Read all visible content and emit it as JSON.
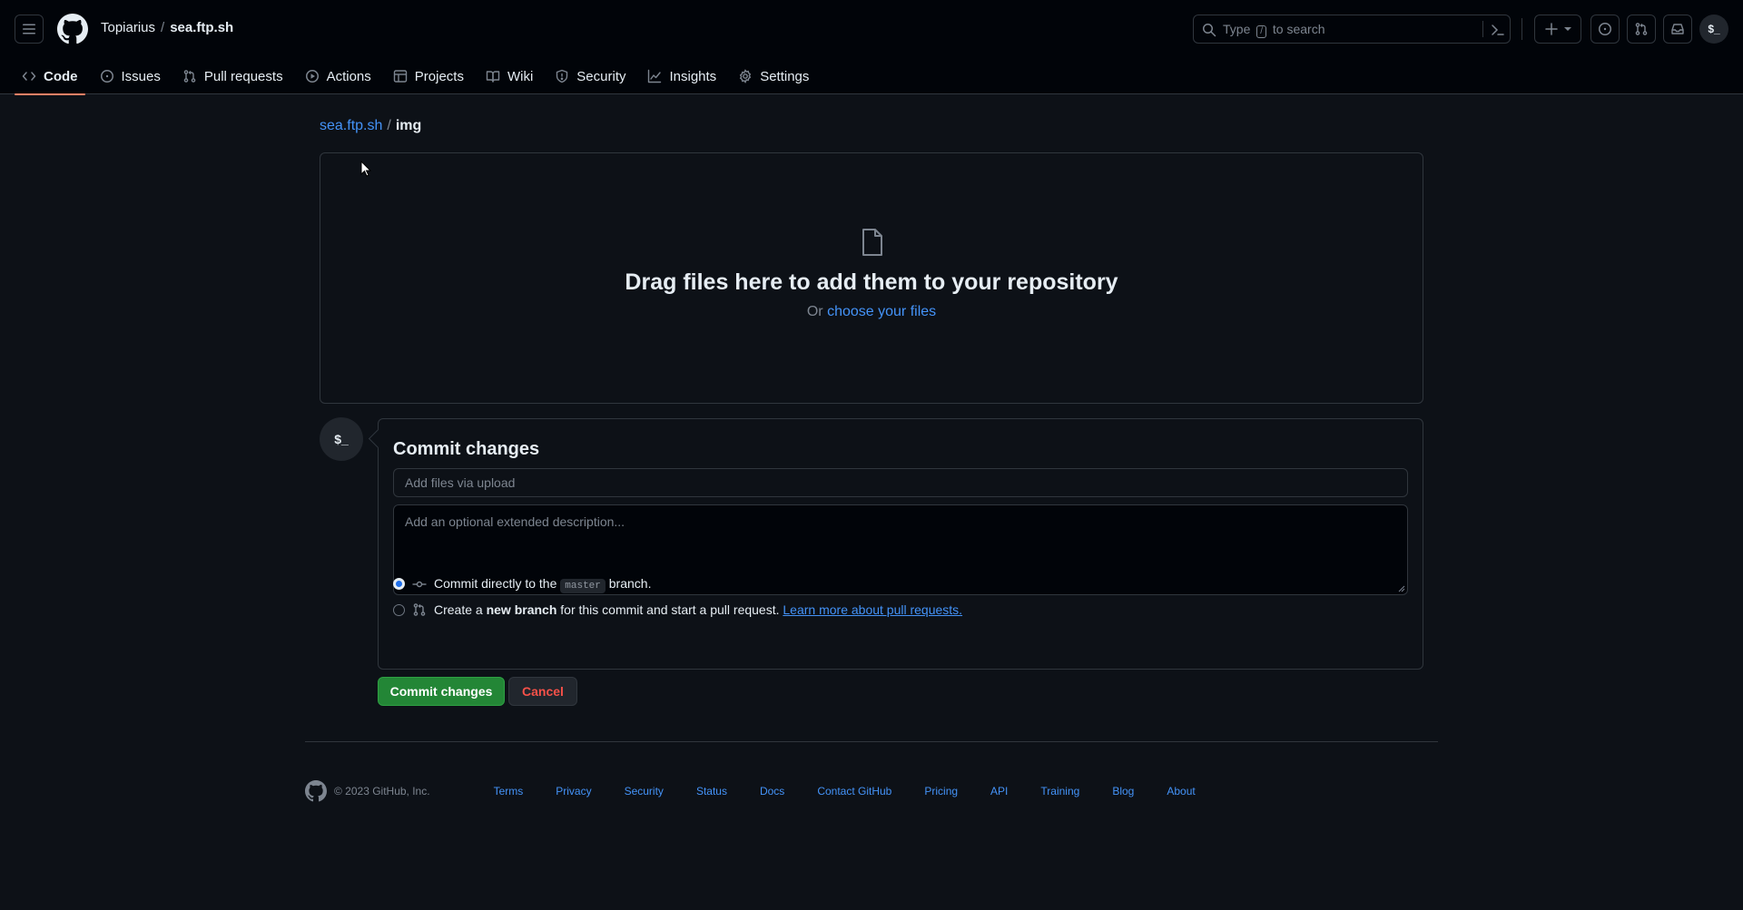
{
  "header": {
    "owner": "Topiarius",
    "separator": "/",
    "repo": "sea.ftp.sh",
    "search": {
      "prefix": "Type",
      "key": "/",
      "suffix": "to search"
    },
    "avatar_text": "$_"
  },
  "nav": {
    "tabs": [
      {
        "label": "Code",
        "icon": "code-icon"
      },
      {
        "label": "Issues",
        "icon": "issue-opened-icon"
      },
      {
        "label": "Pull requests",
        "icon": "git-pull-request-icon"
      },
      {
        "label": "Actions",
        "icon": "play-icon"
      },
      {
        "label": "Projects",
        "icon": "table-icon"
      },
      {
        "label": "Wiki",
        "icon": "book-icon"
      },
      {
        "label": "Security",
        "icon": "shield-icon"
      },
      {
        "label": "Insights",
        "icon": "graph-icon"
      },
      {
        "label": "Settings",
        "icon": "gear-icon"
      }
    ]
  },
  "breadcrumb": {
    "repo": "sea.ftp.sh",
    "separator": "/",
    "folder": "img"
  },
  "dropzone": {
    "title": "Drag files here to add them to your repository",
    "or_text": "Or",
    "choose_link": "choose your files"
  },
  "commit": {
    "avatar_text": "$_",
    "title": "Commit changes",
    "summary_placeholder": "Add files via upload",
    "description_placeholder": "Add an optional extended description...",
    "option_direct": {
      "prefix": "Commit directly to the",
      "branch": "master",
      "suffix": "branch."
    },
    "option_new": {
      "prefix": "Create a",
      "bold": "new branch",
      "suffix": "for this commit and start a pull request.",
      "link": "Learn more about pull requests."
    },
    "commit_button": "Commit changes",
    "cancel_button": "Cancel"
  },
  "footer": {
    "copyright": "© 2023 GitHub, Inc.",
    "links": [
      "Terms",
      "Privacy",
      "Security",
      "Status",
      "Docs",
      "Contact GitHub",
      "Pricing",
      "API",
      "Training",
      "Blog",
      "About"
    ]
  },
  "colors": {
    "background": "#0d1117",
    "header_bg": "#010409",
    "border": "#30363d",
    "link": "#4493f8",
    "active_tab_underline": "#f78166",
    "commit_button": "#238636",
    "cancel_text": "#f85149"
  }
}
